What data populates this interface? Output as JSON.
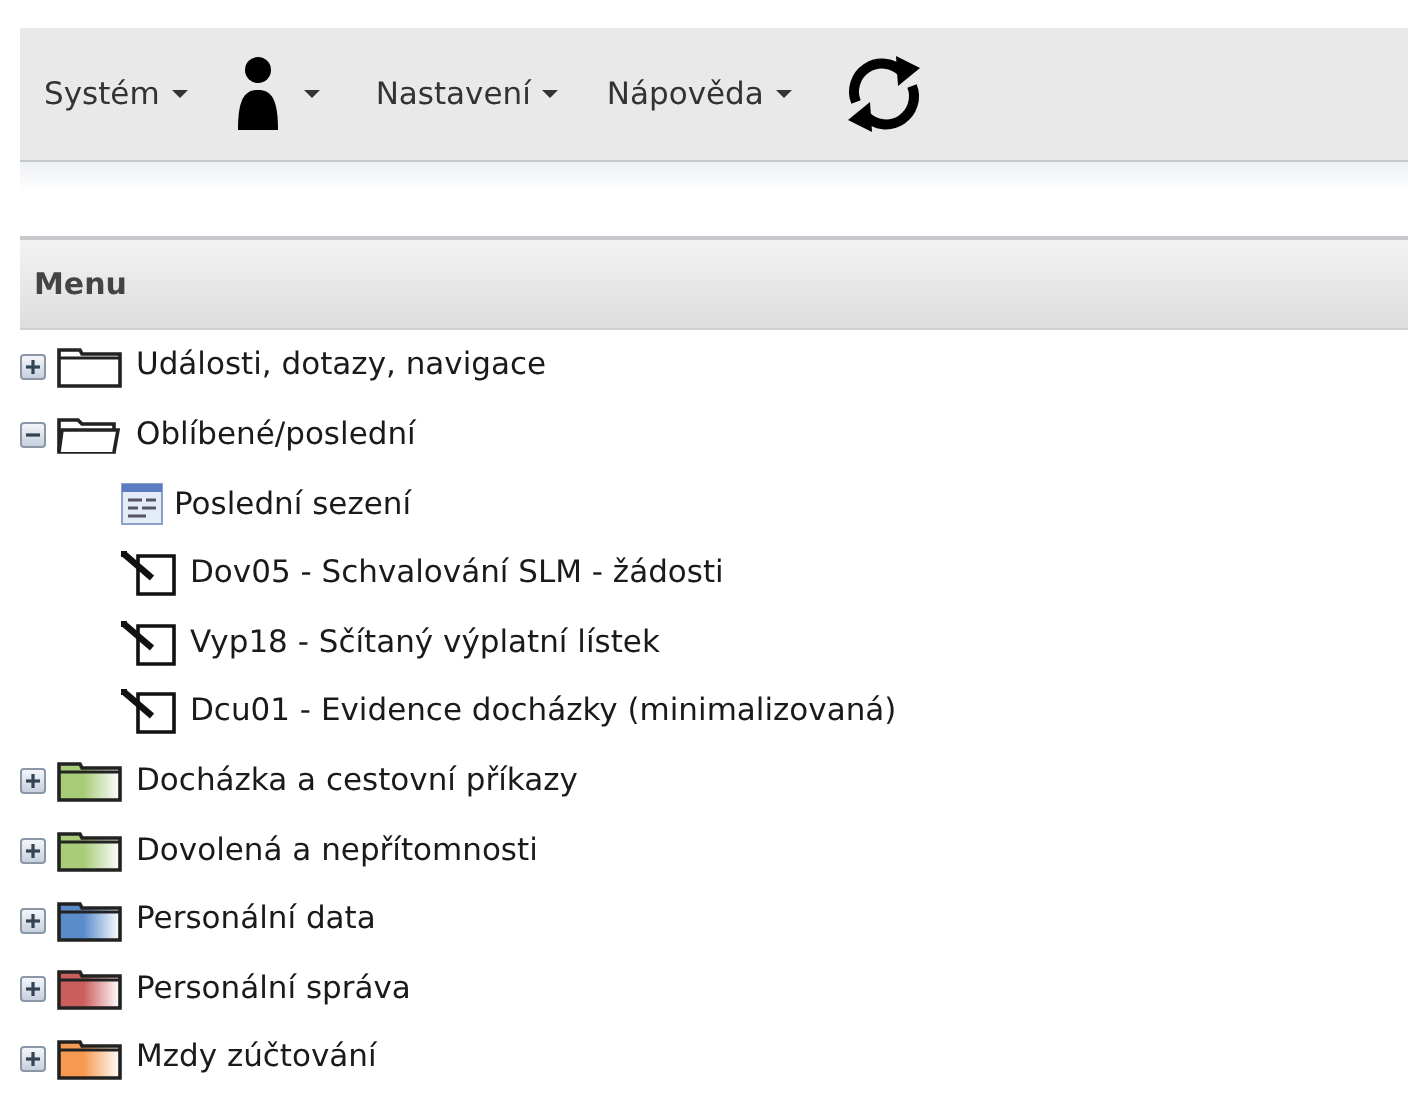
{
  "toolbar": [
    {
      "kind": "menu",
      "label": "Systém"
    },
    {
      "kind": "user-menu"
    },
    {
      "kind": "menu",
      "label": "Nastavení"
    },
    {
      "kind": "menu",
      "label": "Nápověda"
    },
    {
      "kind": "refresh"
    }
  ],
  "menu_panel": {
    "title": "Menu",
    "tree": [
      {
        "kind": "folder",
        "label": "Události, dotazy, navigace",
        "expanded": false
      },
      {
        "kind": "folder",
        "label": "Oblíbené/poslední",
        "expanded": true,
        "children": [
          {
            "kind": "session",
            "label": "Poslední sezení"
          },
          {
            "kind": "form",
            "label": "Dov05 - Schvalování SLM - žádosti"
          },
          {
            "kind": "form",
            "label": "Vyp18 - Sčítaný výplatní lístek"
          },
          {
            "kind": "form",
            "label": "Dcu01 - Evidence docházky (minimalizovaná)"
          }
        ]
      },
      {
        "kind": "folder",
        "label": "Docházka a cestovní příkazy",
        "expanded": false,
        "color": "#a8cc78"
      },
      {
        "kind": "folder",
        "label": "Dovolená a nepřítomnosti",
        "expanded": false,
        "color": "#a8cc78"
      },
      {
        "kind": "folder",
        "label": "Personální data",
        "expanded": false,
        "color": "#5a8ccc"
      },
      {
        "kind": "folder",
        "label": "Personální správa",
        "expanded": false,
        "color": "#cc5e5e"
      },
      {
        "kind": "folder",
        "label": "Mzdy zúčtování",
        "expanded": false,
        "color": "#f59a50"
      }
    ]
  }
}
